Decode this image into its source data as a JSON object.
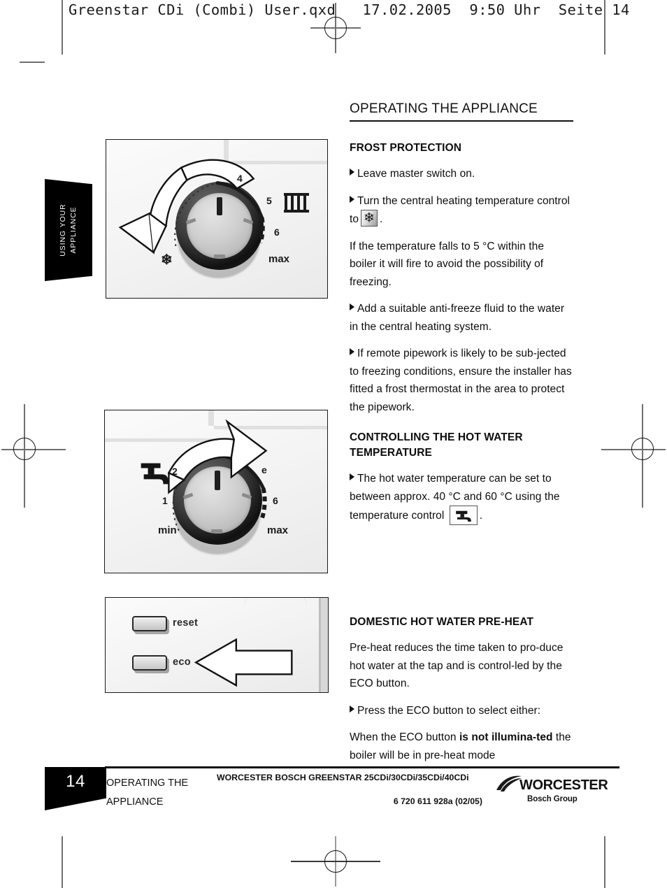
{
  "qxd_header": "Greenstar CDi (Combi) User.qxd   17.02.2005  9:50 Uhr  Seite 14",
  "side_tab": {
    "line1": "USING YOUR",
    "line2": "APPLIANCE"
  },
  "main": {
    "title": "OPERATING THE APPLIANCE",
    "sections": [
      {
        "heading": "FROST PROTECTION",
        "blocks": [
          {
            "bullet": true,
            "text": "Leave master switch on."
          },
          {
            "bullet": true,
            "text": "Turn the central heating temperature control to",
            "icon": "snowflake-icon",
            "after": "."
          },
          {
            "bullet": false,
            "text": "If the temperature falls to 5 °C within the boiler it will fire to avoid the possibility of freezing."
          },
          {
            "bullet": true,
            "text": "Add a suitable anti-freeze fluid to the water in the central heating system."
          },
          {
            "bullet": true,
            "text": "If remote pipework is likely to be sub-jected to freezing conditions, ensure the installer has fitted a frost thermostat in the area to protect the pipework."
          }
        ]
      },
      {
        "heading": "CONTROLLING THE HOT WATER TEMPERATURE",
        "blocks": [
          {
            "bullet": true,
            "text": "The hot water temperature can be set to between approx. 40 °C and 60 °C using the temperature control",
            "icon": "tap-icon",
            "after": "."
          }
        ]
      },
      {
        "heading": "DOMESTIC HOT WATER PRE-HEAT",
        "blocks": [
          {
            "bullet": false,
            "text": "Pre-heat reduces the time taken to pro-duce hot water at the tap and is control-led by the ECO button."
          },
          {
            "bullet": true,
            "text": "Press the ECO button to select either:"
          },
          {
            "bullet": false,
            "text_pre": "When the ECO button ",
            "bold": "is not illumina-ted",
            "text_post": " the boiler will be in pre-heat mode"
          }
        ]
      }
    ]
  },
  "figures": {
    "fig1": {
      "caption_name": "central-heating-control-dial",
      "scale_labels": [
        "4",
        "5",
        "6",
        "max"
      ],
      "snowflake": "❄",
      "radiator_icon": "radiator-icon",
      "arrow_direction": "anticlockwise"
    },
    "fig2": {
      "caption_name": "hot-water-control-dial",
      "scale_labels": [
        "min",
        "1",
        "2",
        "e",
        "6",
        "max"
      ],
      "tap_icon": "tap-icon",
      "arrow_direction": "clockwise"
    },
    "fig3": {
      "caption_name": "reset-eco-buttons",
      "buttons": [
        "reset",
        "eco"
      ],
      "arrow_direction": "left"
    }
  },
  "footer": {
    "page_number": "14",
    "section_line1": "OPERATING THE",
    "section_line2": "APPLIANCE",
    "product_line": "WORCESTER BOSCH GREENSTAR 25CDi/30CDi/35CDi/40CDi",
    "doc_code": "6 720 611 928a (02/05)",
    "brand": "WORCESTER",
    "brand_sub": "Bosch Group"
  },
  "colors": {
    "ink": "#111111",
    "rule": "#111111",
    "badge": "#000000",
    "mark": "#6f6f6f"
  }
}
